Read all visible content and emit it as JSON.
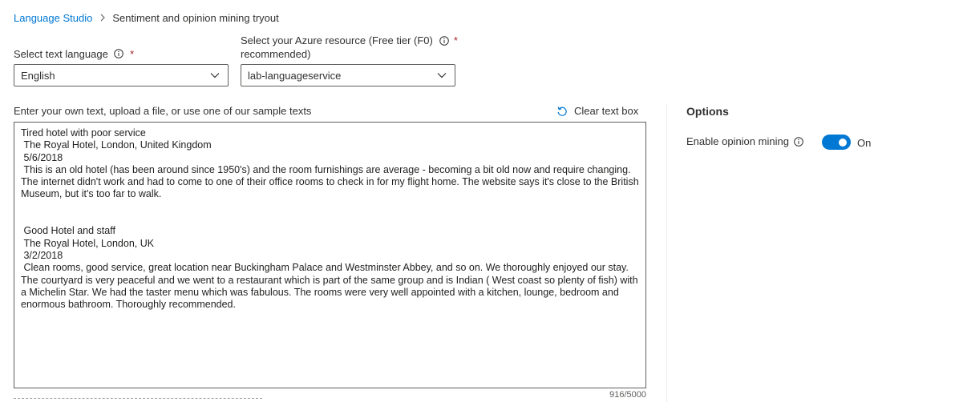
{
  "breadcrumb": {
    "root": "Language Studio",
    "current": "Sentiment and opinion mining tryout"
  },
  "language": {
    "label": "Select text language",
    "required_mark": "*",
    "value": "English"
  },
  "resource": {
    "label_line1": "Select your Azure resource (Free tier (F0)",
    "label_line2": "recommended)",
    "required_mark": "*",
    "value": "lab-languageservice"
  },
  "input": {
    "prompt": "Enter your own text, upload a file, or use one of our sample texts",
    "clear_label": "Clear text box",
    "text": "Tired hotel with poor service\n The Royal Hotel, London, United Kingdom\n 5/6/2018\n This is an old hotel (has been around since 1950's) and the room furnishings are average - becoming a bit old now and require changing. The internet didn't work and had to come to one of their office rooms to check in for my flight home. The website says it's close to the British Museum, but it's too far to walk.\n\n\n Good Hotel and staff\n The Royal Hotel, London, UK\n 3/2/2018\n Clean rooms, good service, great location near Buckingham Palace and Westminster Abbey, and so on. We thoroughly enjoyed our stay. The courtyard is very peaceful and we went to a restaurant which is part of the same group and is Indian ( West coast so plenty of fish) with a Michelin Star. We had the taster menu which was fabulous. The rooms were very well appointed with a kitchen, lounge, bedroom and enormous bathroom. Thoroughly recommended.",
    "char_count": "916/5000"
  },
  "options": {
    "title": "Options",
    "opinion_mining_label": "Enable opinion mining",
    "toggle_state": "On",
    "toggle_on": true
  },
  "colors": {
    "accent": "#0078d4",
    "required": "#a4262c"
  },
  "icons": {
    "breadcrumb_separator": "chevron-right-icon",
    "info": "info-icon",
    "dropdown": "chevron-down-icon",
    "clear": "undo-icon"
  }
}
